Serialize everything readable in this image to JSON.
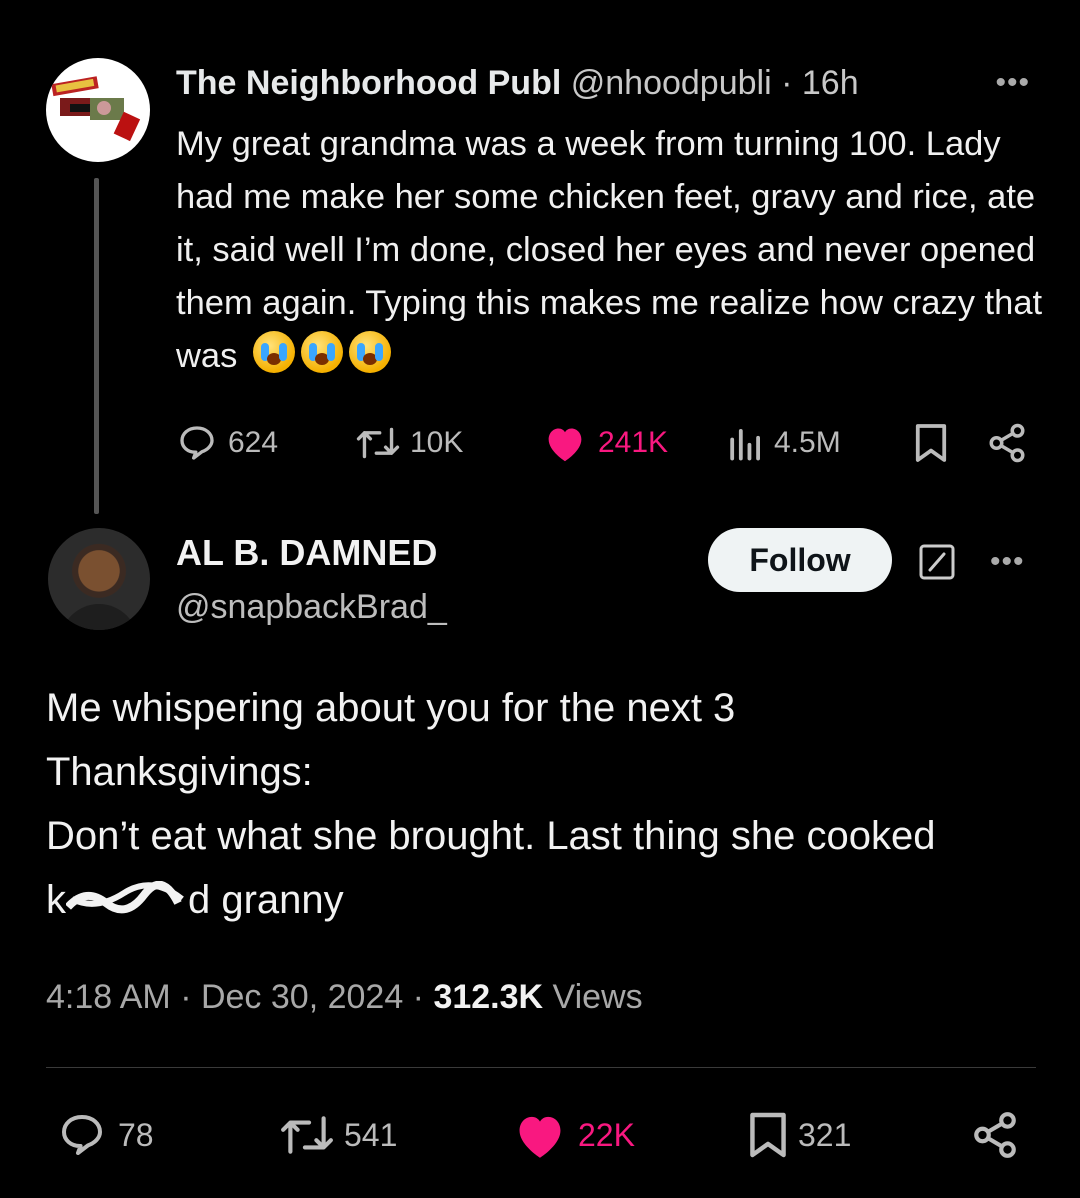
{
  "parent_tweet": {
    "display_name": "The Neighborhood Publ",
    "handle": "@nhoodpubli",
    "age": "16h",
    "more_label": "•••",
    "body_text": "My great grandma was a week from turning 100. Lady had me make her some chicken feet, gravy and rice, ate it, said well I’m done, closed her eyes and never opened them again. Typing this makes me realize how crazy that was",
    "emoji": [
      "loudly-crying-face",
      "loudly-crying-face",
      "loudly-crying-face"
    ],
    "stats": {
      "replies": "624",
      "reposts": "10K",
      "likes": "241K",
      "views": "4.5M"
    }
  },
  "main_tweet": {
    "display_name": "AL B. DAMNED",
    "handle": "@snapbackBrad_",
    "follow_label": "Follow",
    "more_label": "•••",
    "body_line1": "Me whispering about you for the next 3 Thanksgivings:",
    "body_line2": "Don’t eat what she brought. Last thing she cooked ",
    "body_line2_end": " granny",
    "censored_word_visible": "k",
    "censored_word_tail": "d",
    "time": "4:18 AM",
    "date": "Dec 30, 2024",
    "views_count": "312.3K",
    "views_label": "Views",
    "stats": {
      "replies": "78",
      "reposts": "541",
      "likes": "22K",
      "bookmarks": "321"
    }
  },
  "colors": {
    "background": "#000000",
    "like_pink": "#f91880",
    "text_primary": "#e7e9ea",
    "text_secondary": "#a8a8a8"
  }
}
